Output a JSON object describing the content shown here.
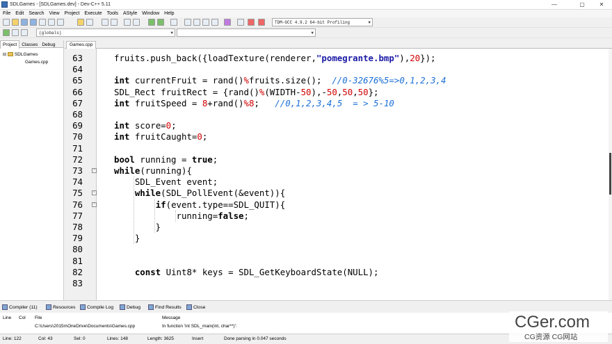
{
  "window": {
    "title": "SDLGames - [SDLGames.dev] - Dev-C++ 5.11",
    "min": "—",
    "max": "▢",
    "close": "✕"
  },
  "menu": [
    "File",
    "Edit",
    "Search",
    "View",
    "Project",
    "Execute",
    "Tools",
    "AStyle",
    "Window",
    "Help"
  ],
  "toolbar": {
    "compiler": "TDM-GCC 4.9.2 64-bit Profiling",
    "scope": "(globals)"
  },
  "project_panel": {
    "tabs": [
      "Project",
      "Classes",
      "Debug"
    ],
    "tree_root": "SDLGames",
    "tree_child": "Games.cpp"
  },
  "editor": {
    "file_tab": "Games.cpp",
    "line_numbers": [
      "63",
      "64",
      "65",
      "66",
      "67",
      "68",
      "69",
      "70",
      "71",
      "72",
      "73",
      "74",
      "75",
      "76",
      "77",
      "78",
      "79",
      "80",
      "81",
      "82",
      "83"
    ],
    "lines": [
      "<span class=\"k\"></span>fruits.push_back({loadTexture(renderer,<span class=\"s\">\"pomegrante.bmp\"</span>),<span class=\"n\">20</span>});",
      "",
      "<span class=\"k\">int</span> currentFruit = rand()<span class=\"o\">%</span>fruits.size();  <span class=\"c\">//0-32676%5=>0,1,2,3,4</span>",
      "SDL_Rect fruitRect = {rand()<span class=\"o\">%</span>(WIDTH-<span class=\"n\">50</span>),-<span class=\"n\">50</span>,<span class=\"n\">50</span>,<span class=\"n\">50</span>};",
      "<span class=\"k\">int</span> fruitSpeed = <span class=\"n\">8</span>+rand()<span class=\"o\">%</span><span class=\"n\">8</span>;   <span class=\"c\">//0,1,2,3,4,5  = > 5-10</span>",
      "",
      "<span class=\"k\">int</span> score=<span class=\"n\">0</span>;",
      "<span class=\"k\">int</span> fruitCaught=<span class=\"n\">0</span>;",
      "",
      "<span class=\"k\">bool</span> running = <span class=\"k\">true</span>;",
      "<span class=\"k\">while</span>(running){",
      "    SDL_Event event;",
      "    <span class=\"k\">while</span>(SDL_PollEvent(&amp;event)){",
      "        <span class=\"k\">if</span>(event.type==SDL_QUIT){",
      "            running=<span class=\"k\">false</span>;",
      "        }",
      "    }",
      "",
      "",
      "    <span class=\"k\">const</span> Uint8* keys = SDL_GetKeyboardState(NULL);",
      ""
    ]
  },
  "bottom_tabs": [
    "Compiler (11)",
    "Resources",
    "Compile Log",
    "Debug",
    "Find Results",
    "Close"
  ],
  "messages": {
    "headers": [
      "Line",
      "Col",
      "File",
      "Message"
    ],
    "file": "C:\\Users\\2015n\\OneDrive\\Documents\\Games.cpp",
    "message": "In function 'int SDL_main(int, char**)':"
  },
  "status": {
    "line": "Line:   122",
    "col": "Col:   43",
    "sel": "Sel:   0",
    "lines": "Lines:   148",
    "length": "Length:  3625",
    "mode": "Insert",
    "info": "Done parsing in 0.047 seconds"
  },
  "watermark": {
    "brand": "CGer.com",
    "sub": "CG资源  CG网站"
  }
}
